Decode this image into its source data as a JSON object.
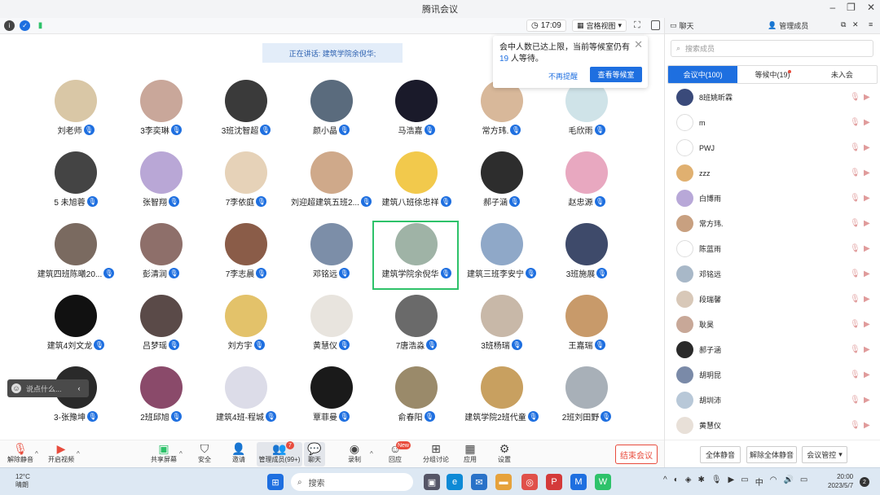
{
  "window": {
    "title": "腾讯会议"
  },
  "toolbar_top": {
    "time": "17:09",
    "view_mode": "宫格视图"
  },
  "speaking_banner": "正在讲话: 建筑学院余倪华;",
  "popup": {
    "text_before": "会中人数已达上限，当前等候室仍有",
    "count": "19",
    "text_after": "人等待。",
    "dismiss": "不再提醒",
    "view_button": "查看等候室"
  },
  "participants": [
    {
      "name": "刘老师",
      "color": "#d9c7a6"
    },
    {
      "name": "3李奕琳",
      "color": "#c9a79a"
    },
    {
      "name": "3班沈智超",
      "color": "#3a3a3a"
    },
    {
      "name": "颜小晶",
      "color": "#5a6b7d"
    },
    {
      "name": "马浩嘉",
      "color": "#1a1a2a"
    },
    {
      "name": "常方玮.",
      "color": "#d8b89a"
    },
    {
      "name": "毛欣雨",
      "color": "#cfe3e8"
    },
    {
      "name": "5 未旭蓉",
      "color": "#444444"
    },
    {
      "name": "张智翔",
      "color": "#b9a7d6"
    },
    {
      "name": "7李依庭",
      "color": "#e6d2b8"
    },
    {
      "name": "刘迎超建筑五班2...",
      "color": "#cfa98a"
    },
    {
      "name": "建筑八班徐忠祥",
      "color": "#f2c94c"
    },
    {
      "name": "郝子涵",
      "color": "#2d2d2d"
    },
    {
      "name": "赵忠源",
      "color": "#e8a8c0"
    },
    {
      "name": "建筑四班陈曦20...",
      "color": "#7a6a60"
    },
    {
      "name": "彭清润",
      "color": "#8e6f6a"
    },
    {
      "name": "7李志晨",
      "color": "#8a5c48"
    },
    {
      "name": "邓铭远",
      "color": "#7c8ea8"
    },
    {
      "name": "建筑学院余倪华",
      "color": "#9fb3a6"
    },
    {
      "name": "建筑三班李安宁",
      "color": "#8fa8c8"
    },
    {
      "name": "3班施展",
      "color": "#3e4a6a"
    },
    {
      "name": "建筑4刘文龙",
      "color": "#111111"
    },
    {
      "name": "吕梦瑶",
      "color": "#5a4a48"
    },
    {
      "name": "刘方宇",
      "color": "#e3c26a"
    },
    {
      "name": "黄慧仪",
      "color": "#e8e4de"
    },
    {
      "name": "7唐浩淼",
      "color": "#6a6a6a"
    },
    {
      "name": "3班杨瑞",
      "color": "#c8b8a8"
    },
    {
      "name": "王嘉瑞",
      "color": "#c89a6a"
    },
    {
      "name": "3-张豫坤",
      "color": "#2a2a2a"
    },
    {
      "name": "2班邱旭",
      "color": "#8a4a6a"
    },
    {
      "name": "建筑4班-程城",
      "color": "#dcdce8"
    },
    {
      "name": "覃菲曼",
      "color": "#1a1a1a"
    },
    {
      "name": "俞春阳",
      "color": "#9a8a6a"
    },
    {
      "name": "建筑学院2班代童",
      "color": "#c8a060"
    },
    {
      "name": "2班刘田野",
      "color": "#a8b0b8"
    }
  ],
  "chat_float": "说点什么...",
  "bottom_toolbar": {
    "unmute": "解除静音",
    "start_video": "开启视频",
    "share_screen": "共享屏幕",
    "security": "安全",
    "invite": "邀请",
    "manage_members": "管理成员(99+)",
    "manage_badge": "7",
    "chat": "聊天",
    "record": "录制",
    "apps_badge": "New",
    "interact": "回应",
    "breakout": "分组讨论",
    "apps": "应用",
    "settings": "设置",
    "end_meeting": "结束会议"
  },
  "right_panel": {
    "tab_chat": "聊天",
    "tab_members": "管理成员",
    "search_placeholder": "搜索成员",
    "seg_in_meeting": "会议中(100)",
    "seg_waiting": "等候中(19)",
    "seg_not_joined": "未入会",
    "members": [
      {
        "name": "8班姚昕霖",
        "color": "#3a4a7a"
      },
      {
        "name": "m",
        "color": "#ffffff"
      },
      {
        "name": "PWJ",
        "color": "#ffffff"
      },
      {
        "name": "zzz",
        "color": "#e0b070"
      },
      {
        "name": "白博雨",
        "color": "#b8a8d8"
      },
      {
        "name": "常方玮.",
        "color": "#c8a080"
      },
      {
        "name": "陈蓝雨",
        "color": "#ffffff"
      },
      {
        "name": "邓铭远",
        "color": "#a8b8c8"
      },
      {
        "name": "段瑞馨",
        "color": "#d8c8b8"
      },
      {
        "name": "耿昊",
        "color": "#c8a898"
      },
      {
        "name": "郝子涵",
        "color": "#2a2a2a"
      },
      {
        "name": "胡玥昆",
        "color": "#7a8aa8"
      },
      {
        "name": "胡圳沛",
        "color": "#b8c8d8"
      },
      {
        "name": "黄慧仪",
        "color": "#e8e0d8"
      }
    ],
    "mute_all": "全体静音",
    "unmute_all": "解除全体静音",
    "meeting_control": "会议管控"
  },
  "taskbar": {
    "weather_temp": "12°C",
    "weather_text": "晴朗",
    "search": "搜索",
    "time": "20:00",
    "date": "2023/5/7",
    "notif_count": "2"
  }
}
